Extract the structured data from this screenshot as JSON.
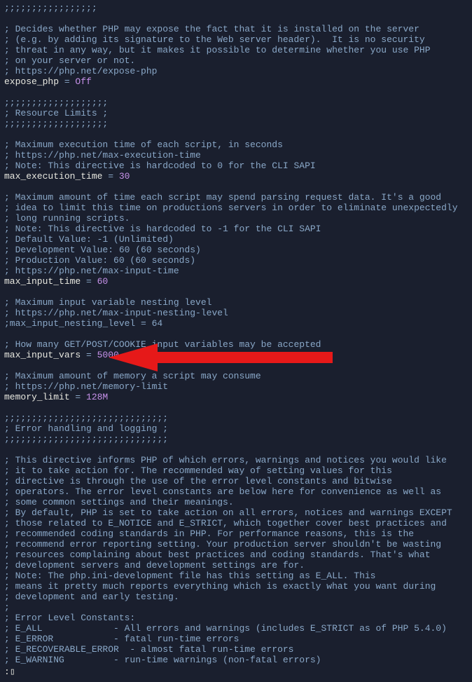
{
  "lines": {
    "l01": ";;;;;;;;;;;;;;;;;",
    "l02": "",
    "l03": "; Decides whether PHP may expose the fact that it is installed on the server",
    "l04": "; (e.g. by adding its signature to the Web server header).  It is no security",
    "l05": "; threat in any way, but it makes it possible to determine whether you use PHP",
    "l06": "; on your server or not.",
    "l07": "; https://php.net/expose-php",
    "d01_key": "expose_php",
    "d01_eq": " = ",
    "d01_val": "Off",
    "l08": "",
    "l09": ";;;;;;;;;;;;;;;;;;;",
    "l10": "; Resource Limits ;",
    "l11": ";;;;;;;;;;;;;;;;;;;",
    "l12": "",
    "l13": "; Maximum execution time of each script, in seconds",
    "l14": "; https://php.net/max-execution-time",
    "l15": "; Note: This directive is hardcoded to 0 for the CLI SAPI",
    "d02_key": "max_execution_time",
    "d02_eq": " = ",
    "d02_val": "30",
    "l16": "",
    "l17": "; Maximum amount of time each script may spend parsing request data. It's a good",
    "l18": "; idea to limit this time on productions servers in order to eliminate unexpectedly",
    "l19": "; long running scripts.",
    "l20": "; Note: This directive is hardcoded to -1 for the CLI SAPI",
    "l21": "; Default Value: -1 (Unlimited)",
    "l22": "; Development Value: 60 (60 seconds)",
    "l23": "; Production Value: 60 (60 seconds)",
    "l24": "; https://php.net/max-input-time",
    "d03_key": "max_input_time",
    "d03_eq": " = ",
    "d03_val": "60",
    "l25": "",
    "l26": "; Maximum input variable nesting level",
    "l27": "; https://php.net/max-input-nesting-level",
    "l28": ";max_input_nesting_level = 64",
    "l29": "",
    "l30": "; How many GET/POST/COOKIE input variables may be accepted",
    "d04_key": "max_input_vars",
    "d04_eq": " = ",
    "d04_val": "5000",
    "l31": "",
    "l32": "; Maximum amount of memory a script may consume",
    "l33": "; https://php.net/memory-limit",
    "d05_key": "memory_limit",
    "d05_eq": " = ",
    "d05_val": "128M",
    "l34": "",
    "l35": ";;;;;;;;;;;;;;;;;;;;;;;;;;;;;;",
    "l36": "; Error handling and logging ;",
    "l37": ";;;;;;;;;;;;;;;;;;;;;;;;;;;;;;",
    "l38": "",
    "l39": "; This directive informs PHP of which errors, warnings and notices you would like",
    "l40": "; it to take action for. The recommended way of setting values for this",
    "l41": "; directive is through the use of the error level constants and bitwise",
    "l42": "; operators. The error level constants are below here for convenience as well as",
    "l43": "; some common settings and their meanings.",
    "l44": "; By default, PHP is set to take action on all errors, notices and warnings EXCEPT",
    "l45": "; those related to E_NOTICE and E_STRICT, which together cover best practices and",
    "l46": "; recommended coding standards in PHP. For performance reasons, this is the",
    "l47": "; recommend error reporting setting. Your production server shouldn't be wasting",
    "l48": "; resources complaining about best practices and coding standards. That's what",
    "l49": "; development servers and development settings are for.",
    "l50": "; Note: The php.ini-development file has this setting as E_ALL. This",
    "l51": "; means it pretty much reports everything which is exactly what you want during",
    "l52": "; development and early testing.",
    "l53": ";",
    "l54": "; Error Level Constants:",
    "l55": "; E_ALL             - All errors and warnings (includes E_STRICT as of PHP 5.4.0)",
    "l56": "; E_ERROR           - fatal run-time errors",
    "l57": "; E_RECOVERABLE_ERROR  - almost fatal run-time errors",
    "l58": "; E_WARNING         - run-time warnings (non-fatal errors)",
    "cursor": ":"
  },
  "status_bracket": "▯"
}
